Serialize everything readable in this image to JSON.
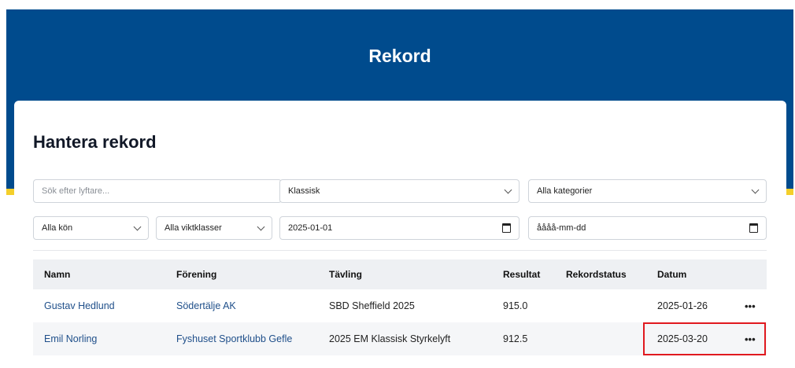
{
  "header": {
    "title": "Rekord"
  },
  "card": {
    "title": "Hantera rekord"
  },
  "filters": {
    "search_placeholder": "Sök efter lyftare...",
    "style_value": "Klassisk",
    "category_value": "Alla kategorier",
    "gender_value": "Alla kön",
    "weightclass_value": "Alla viktklasser",
    "date_from_value": "2025-01-01",
    "date_to_placeholder": "åååå-mm-dd"
  },
  "table": {
    "columns": [
      "Namn",
      "Förening",
      "Tävling",
      "Resultat",
      "Rekordstatus",
      "Datum"
    ],
    "rows": [
      {
        "name": "Gustav Hedlund",
        "club": "Södertälje AK",
        "competition": "SBD Sheffield 2025",
        "result": "915.0",
        "status": "",
        "date": "2025-01-26",
        "actions": "•••"
      },
      {
        "name": "Emil Norling",
        "club": "Fyshuset Sportklubb Gefle",
        "competition": "2025 EM Klassisk Styrkelyft",
        "result": "912.5",
        "status": "",
        "date": "2025-03-20",
        "actions": "•••"
      }
    ]
  },
  "colors": {
    "header_bg": "#004b8d",
    "accent_yellow": "#f4cf2a",
    "highlight": "#e0191f",
    "link": "#1f4f8a"
  }
}
